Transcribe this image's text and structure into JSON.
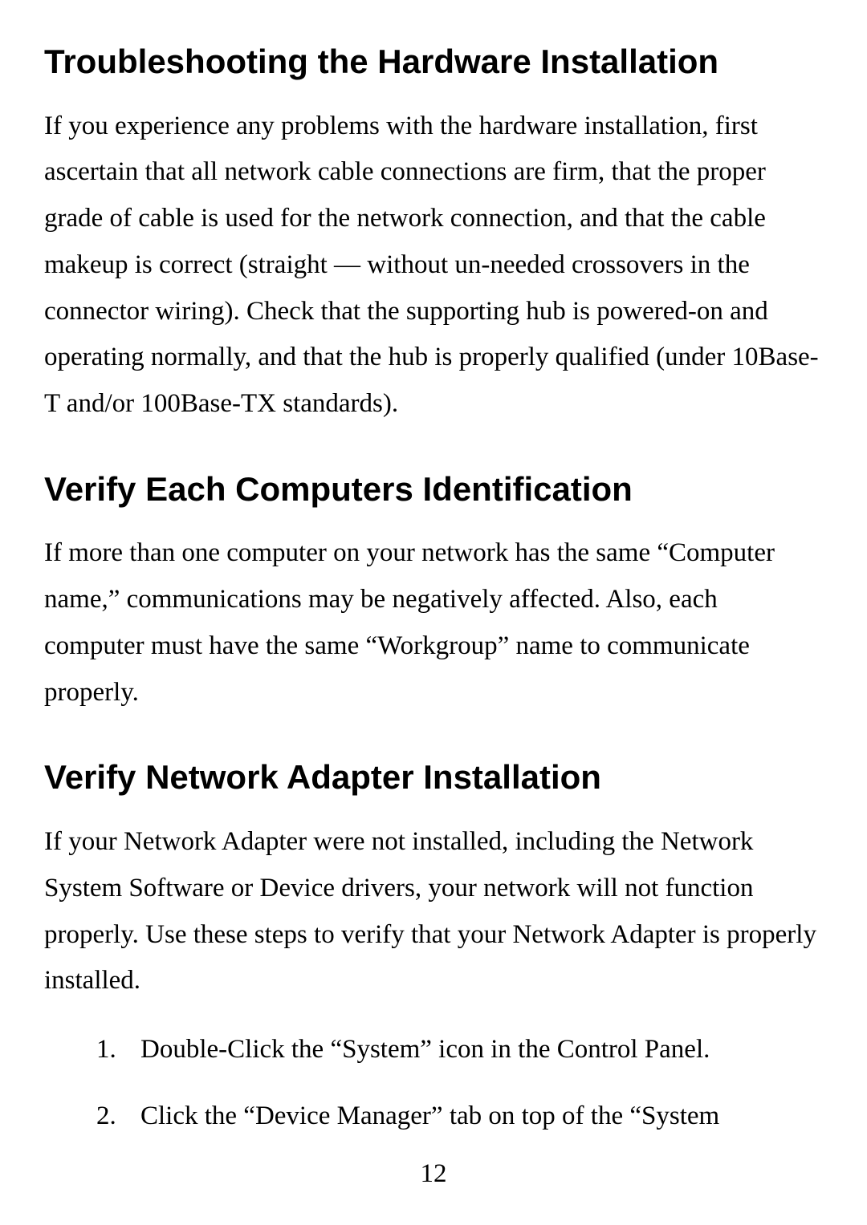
{
  "sections": {
    "section1": {
      "heading": "Troubleshooting the Hardware Installation",
      "body": "If you experience any problems with the hardware installation, first ascertain that all network cable connections are firm, that the proper grade of cable is used for the network connection, and that the cable makeup is correct (straight — without un-needed crossovers in the connector wiring). Check that the supporting hub is powered-on and operating normally, and that the hub is properly qualified (under 10Base-T and/or 100Base-TX standards)."
    },
    "section2": {
      "heading": "Verify Each Computers Identification",
      "body": "If more than one computer on your network has the same “Computer name,” communications may be negatively affected. Also, each computer must have the same “Workgroup” name to communicate properly."
    },
    "section3": {
      "heading": "Verify Network Adapter Installation",
      "body": "If your Network Adapter were not installed, including the Network System Software or Device drivers, your network will not function properly. Use these steps to verify that your Network Adapter is properly installed."
    }
  },
  "list": {
    "item1": {
      "number": "1.",
      "text": "Double-Click the “System” icon in the Control Panel."
    },
    "item2": {
      "number": "2.",
      "text": "Click the “Device Manager” tab on top of the “System"
    }
  },
  "pageNumber": "12"
}
